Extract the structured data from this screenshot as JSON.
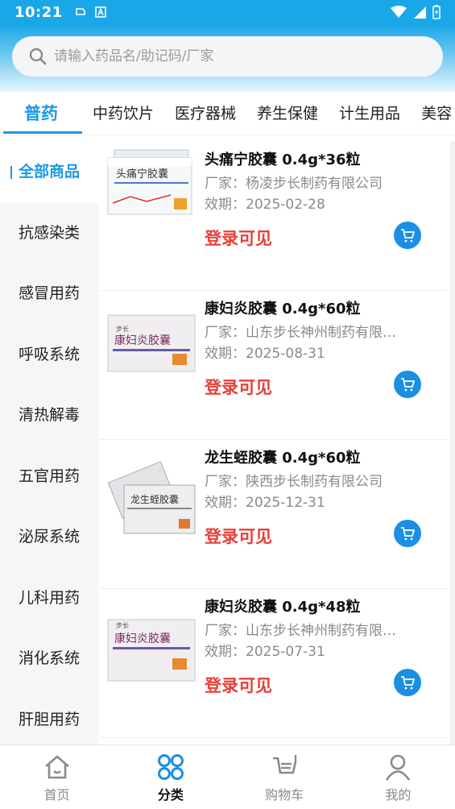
{
  "status_bar": {
    "time": "10:21"
  },
  "search": {
    "placeholder": "请输入药品名/助记码/厂家"
  },
  "top_tabs": [
    "普药",
    "中药饮片",
    "医疗器械",
    "养生保健",
    "计生用品",
    "美容"
  ],
  "sidebar": {
    "items": [
      {
        "label": "全部商品",
        "active": true
      },
      {
        "label": "抗感染类"
      },
      {
        "label": "感冒用药"
      },
      {
        "label": "呼吸系统"
      },
      {
        "label": "清热解毒"
      },
      {
        "label": "五官用药"
      },
      {
        "label": "泌尿系统"
      },
      {
        "label": "儿科用药"
      },
      {
        "label": "消化系统"
      },
      {
        "label": "肝胆用药"
      }
    ]
  },
  "products": [
    {
      "name": "头痛宁胶囊 0.4g*36粒",
      "maker": "厂家：杨凌步长制药有限公司",
      "expiry": "效期：2025-02-28",
      "price": "登录可见",
      "box_text": "头痛宁胶囊",
      "box_color": "#d9322c"
    },
    {
      "name": "康妇炎胶囊 0.4g*60粒",
      "maker": "厂家：山东步长神州制药有限…",
      "expiry": "效期：2025-08-31",
      "price": "登录可见",
      "box_text": "康妇炎胶囊",
      "box_color": "#8a3a6a"
    },
    {
      "name": "龙生蛭胶囊 0.4g*60粒",
      "maker": "厂家：陕西步长制药有限公司",
      "expiry": "效期：2025-12-31",
      "price": "登录可见",
      "box_text": "龙生蛭胶囊",
      "box_color": "#3a3a3a"
    },
    {
      "name": "康妇炎胶囊 0.4g*48粒",
      "maker": "厂家：山东步长神州制药有限…",
      "expiry": "效期：2025-07-31",
      "price": "登录可见",
      "box_text": "康妇炎胶囊",
      "box_color": "#8a3a6a"
    }
  ],
  "bottom_nav": [
    {
      "label": "首页",
      "icon": "home-icon"
    },
    {
      "label": "分类",
      "icon": "category-icon",
      "active": true
    },
    {
      "label": "购物车",
      "icon": "cart-icon"
    },
    {
      "label": "我的",
      "icon": "user-icon"
    }
  ],
  "colors": {
    "accent": "#1a9ae0",
    "price": "#e8403a",
    "header": "#1aa7e8"
  }
}
